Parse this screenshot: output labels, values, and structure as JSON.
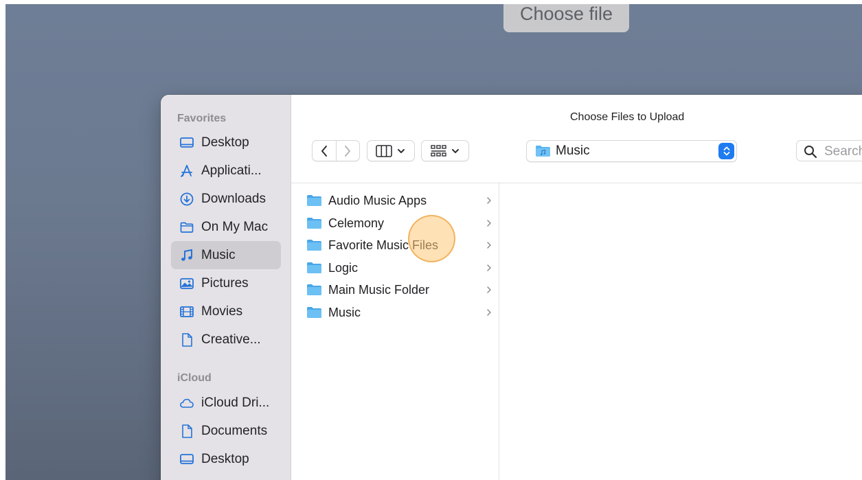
{
  "page": {
    "choose_file_button": "Choose file"
  },
  "dialog": {
    "title": "Choose Files to Upload",
    "path_popup": {
      "label": "Music"
    },
    "search": {
      "placeholder": "Search"
    }
  },
  "sidebar": {
    "favorites_header": "Favorites",
    "icloud_header": "iCloud",
    "favorites": [
      {
        "label": "Desktop",
        "icon": "desktop-icon"
      },
      {
        "label": "Applicati...",
        "icon": "applications-icon"
      },
      {
        "label": "Downloads",
        "icon": "downloads-icon"
      },
      {
        "label": "On My Mac",
        "icon": "folder-icon"
      },
      {
        "label": "Music",
        "icon": "music-note-icon",
        "selected": true
      },
      {
        "label": "Pictures",
        "icon": "pictures-icon"
      },
      {
        "label": "Movies",
        "icon": "film-icon"
      },
      {
        "label": "Creative...",
        "icon": "document-icon"
      }
    ],
    "icloud": [
      {
        "label": "iCloud Dri...",
        "icon": "cloud-icon"
      },
      {
        "label": "Documents",
        "icon": "document-icon"
      },
      {
        "label": "Desktop",
        "icon": "desktop-icon"
      }
    ]
  },
  "files": [
    {
      "name": "Audio Music Apps",
      "kind": "folder"
    },
    {
      "name": "Celemony",
      "kind": "folder"
    },
    {
      "name": "Favorite Music Files",
      "kind": "folder"
    },
    {
      "name": "Logic",
      "kind": "folder"
    },
    {
      "name": "Main Music Folder",
      "kind": "folder"
    },
    {
      "name": "Music",
      "kind": "folder"
    }
  ],
  "colors": {
    "accent": "#1f7bf0",
    "folder_blue": "#5ab4f0",
    "sidebar_icon": "#2573d9",
    "click_highlight": "#fdc878"
  }
}
